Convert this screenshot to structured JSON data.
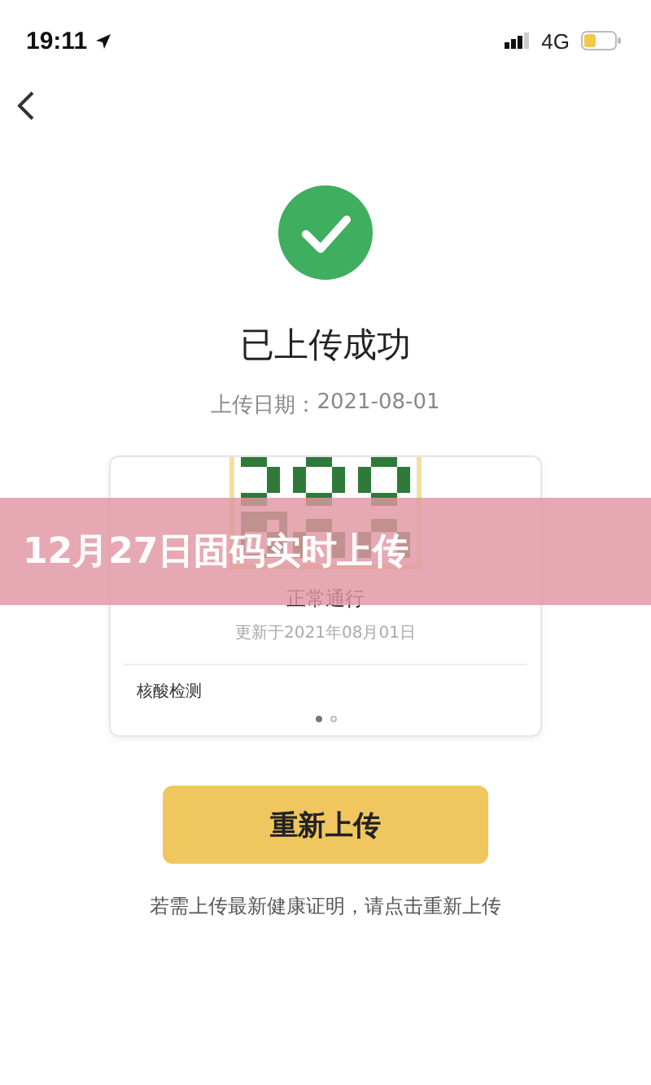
{
  "status_bar": {
    "time": "19:11",
    "network": "4G"
  },
  "result": {
    "title": "已上传成功",
    "date_label": "上传日期：",
    "date": "2021-08-01"
  },
  "card": {
    "status": "正常通行",
    "updated": "更新于2021年08月01日",
    "section": "核酸检测",
    "pages": [
      {
        "selected": true
      },
      {
        "selected": false
      }
    ]
  },
  "button": "重新上传",
  "note": "若需上传最新健康证明，请点击重新上传",
  "banner": "12月27日固码实时上传"
}
